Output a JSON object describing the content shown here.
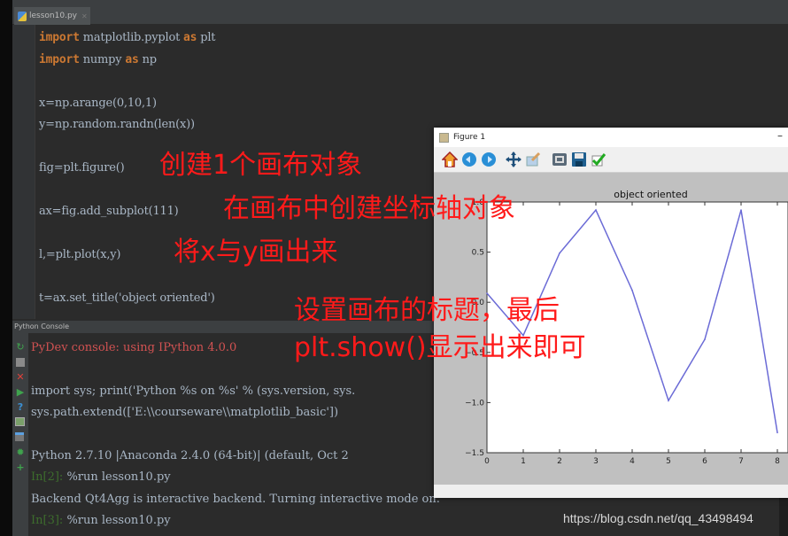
{
  "editor": {
    "tab_label": "lesson10.py",
    "lines": [
      {
        "kw": "import",
        "rest": " matplotlib.pyplot ",
        "kw2": "as",
        "rest2": " plt"
      },
      {
        "kw": "import",
        "rest": " numpy ",
        "kw2": "as",
        "rest2": " np"
      },
      {
        "text": "x=np.arange(0,10,1)"
      },
      {
        "text": "y=np.random.randn(len(x))"
      },
      {
        "text": "fig=plt.figure()"
      },
      {
        "text": "ax=fig.add_subplot(111)"
      },
      {
        "text": "l,=plt.plot(x,y)"
      },
      {
        "text": "t=ax.set_title('object oriented')"
      }
    ]
  },
  "annotations": {
    "a1": "创建1个画布对象",
    "a2": "在画布中创建坐标轴对象",
    "a3": "将x与y画出来",
    "a4": "设置画布的标题，最后",
    "a5": "plt.show()显示出来即可"
  },
  "console": {
    "header": "Python Console",
    "lines": {
      "l1": "PyDev console: using IPython 4.0.0",
      "l2": "import sys; print('Python %s on %s' % (sys.version, sys.",
      "l3": "sys.path.extend(['E:\\\\courseware\\\\matplotlib_basic'])",
      "l4": "Python 2.7.10 |Anaconda 2.4.0 (64-bit)| (default, Oct 2",
      "l5_prompt": "In[2]:",
      "l5_cmd": " %run lesson10.py",
      "l6": "Backend Qt4Agg is interactive backend. Turning interactive mode on.",
      "l7_prompt": "In[3]:",
      "l7_cmd": " %run lesson10.py"
    },
    "toolbar_icons": [
      "rerun-icon",
      "stop-icon",
      "close-icon",
      "run-icon",
      "help-icon",
      "variables-icon",
      "history-icon",
      "debug-icon",
      "add-icon"
    ]
  },
  "figure": {
    "window_title": "Figure 1",
    "minimize_glyph": "–",
    "toolbar": [
      "home-icon",
      "back-icon",
      "forward-icon",
      "pan-icon",
      "zoom-icon",
      "subplots-icon",
      "save-icon",
      "edit-icon"
    ]
  },
  "chart_data": {
    "type": "line",
    "title": "object oriented",
    "xlabel": "",
    "ylabel": "",
    "x": [
      0,
      1,
      2,
      3,
      4,
      5,
      6,
      7,
      8
    ],
    "series": [
      {
        "name": "l",
        "color": "#6b6bd6",
        "values": [
          0.09,
          -0.33,
          0.49,
          0.92,
          0.12,
          -0.98,
          -0.37,
          0.92,
          -1.3
        ]
      }
    ],
    "xticks": [
      "0",
      "1",
      "2",
      "3",
      "4",
      "5",
      "6",
      "7",
      "8"
    ],
    "yticks": [
      "−1.5",
      "−1.0",
      "−0.5",
      "0.0",
      "0.5",
      "1.0"
    ],
    "ytick_values": [
      -1.5,
      -1.0,
      -0.5,
      0.0,
      0.5,
      1.0
    ],
    "xlim": [
      0,
      8.2
    ],
    "ylim": [
      -1.5,
      1.0
    ],
    "grid": false,
    "legend": "none"
  },
  "watermark": "https://blog.csdn.net/qq_43498494"
}
